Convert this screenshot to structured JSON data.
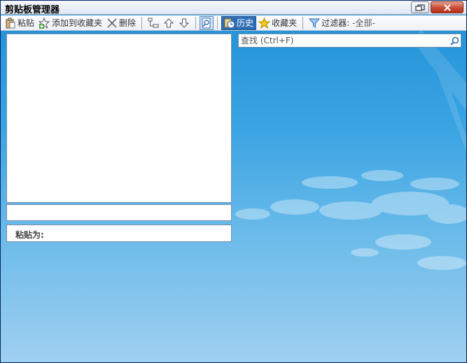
{
  "window": {
    "title": "剪贴板管理器",
    "restore_icon": "restore-icon",
    "close_icon": "close-x-icon"
  },
  "toolbar": {
    "paste_label": "粘贴",
    "add_favorite_label": "添加到收藏夹",
    "delete_label": "删除",
    "history_label": "历史",
    "favorites_label": "收藏夹",
    "filter_label": "过滤器:",
    "filter_value": "-全部-"
  },
  "search": {
    "placeholder": "查找 (Ctrl+F)"
  },
  "paste_as": {
    "label": "粘贴为:"
  },
  "colors": {
    "accent": "#2f6fb6",
    "background_top": "#1e8fd6",
    "background_bottom": "#9fd0f0"
  }
}
